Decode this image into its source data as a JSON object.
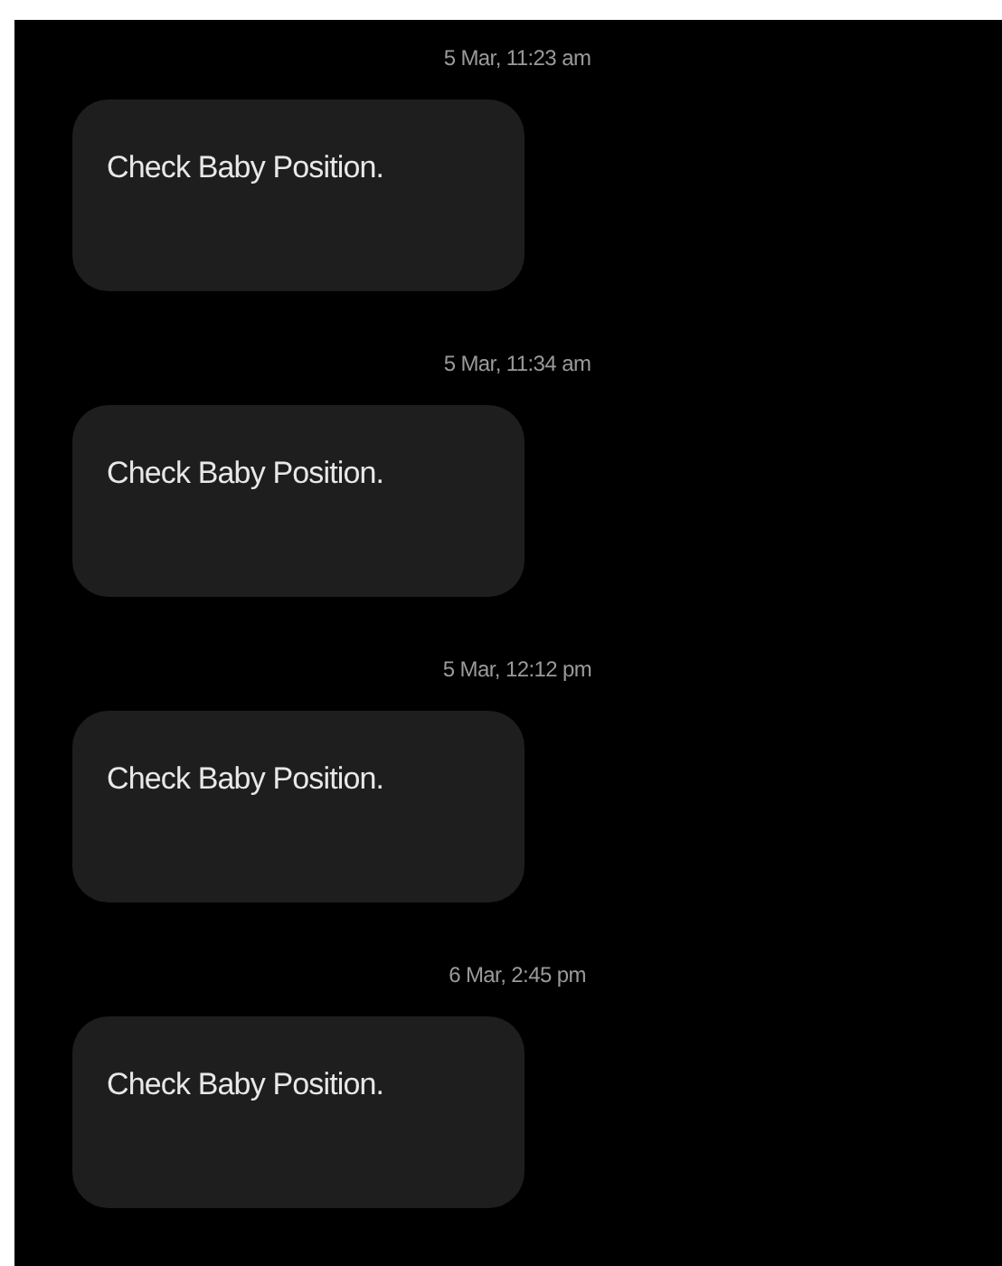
{
  "messages": [
    {
      "timestamp": "5 Mar, 11:23 am",
      "text": "Check Baby Position."
    },
    {
      "timestamp": "5 Mar, 11:34 am",
      "text": "Check Baby Position."
    },
    {
      "timestamp": "5 Mar, 12:12 pm",
      "text": "Check Baby Position."
    },
    {
      "timestamp": "6 Mar, 2:45 pm",
      "text": "Check Baby Position."
    }
  ]
}
